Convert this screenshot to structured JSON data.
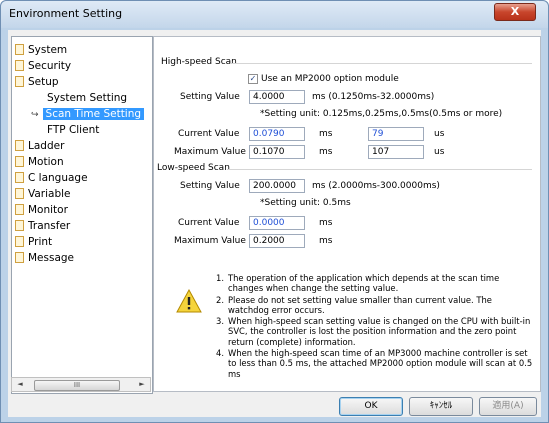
{
  "window": {
    "title": "Environment Setting",
    "close_glyph": "X"
  },
  "tree": {
    "items": [
      {
        "label": "System",
        "icon": "page-icon"
      },
      {
        "label": "Security",
        "icon": "page-icon"
      },
      {
        "label": "Setup",
        "icon": "page-icon"
      },
      {
        "label": "System Setting"
      },
      {
        "label": "Scan Time Setting",
        "selected": true
      },
      {
        "label": "FTP Client"
      },
      {
        "label": "Ladder",
        "icon": "page-icon"
      },
      {
        "label": "Motion",
        "icon": "page-icon"
      },
      {
        "label": "C language",
        "icon": "page-icon"
      },
      {
        "label": "Variable",
        "icon": "page-icon"
      },
      {
        "label": "Monitor",
        "icon": "page-icon"
      },
      {
        "label": "Transfer",
        "icon": "page-icon"
      },
      {
        "label": "Print",
        "icon": "page-icon"
      },
      {
        "label": "Message",
        "icon": "page-icon"
      }
    ],
    "selected_arrow": "↪",
    "scroll": {
      "left": "◄",
      "thumb": "III",
      "right": "►"
    }
  },
  "high_speed": {
    "title": "High-speed Scan",
    "option_label": "Use an MP2000 option module",
    "option_checked": true,
    "setting_label": "Setting Value",
    "setting_value": "4.0000",
    "setting_range": "ms (0.1250ms-32.0000ms)",
    "setting_unit_note": "*Setting unit: 0.125ms,0.25ms,0.5ms(0.5ms or more)",
    "current_label": "Current Value",
    "current_ms": "0.0790",
    "current_us": "79",
    "maximum_label": "Maximum Value",
    "maximum_ms": "0.1070",
    "maximum_us": "107",
    "unit_ms": "ms",
    "unit_us": "us"
  },
  "low_speed": {
    "title": "Low-speed Scan",
    "setting_label": "Setting Value",
    "setting_value": "200.0000",
    "setting_range": "ms (2.0000ms-300.0000ms)",
    "setting_unit_note": "*Setting unit: 0.5ms",
    "current_label": "Current Value",
    "current_ms": "0.0000",
    "maximum_label": "Maximum Value",
    "maximum_ms": "0.2000",
    "unit_ms": "ms"
  },
  "notes": [
    {
      "num": "1.",
      "text": "The operation of the application which depends at the scan time changes when change the setting value."
    },
    {
      "num": "2.",
      "text": "Please do not set setting value smaller than current value. The watchdog error occurs."
    },
    {
      "num": "3.",
      "text": "When high-speed scan setting value is changed on the CPU with built-in SVC, the controller is lost the position information and the zero point return (complete) information."
    },
    {
      "num": "4.",
      "text": "When the high-speed scan time of an MP3000 machine controller is set to less than 0.5 ms, the attached MP2000 option module will scan at 0.5 ms"
    }
  ],
  "buttons": {
    "ok": "OK",
    "cancel": "ｷｬﾝｾﾙ",
    "apply": "適用(A)"
  },
  "colors": {
    "accent_blue": "#1f4fd6",
    "selection": "#3399ff",
    "close_red": "#c8452c"
  }
}
